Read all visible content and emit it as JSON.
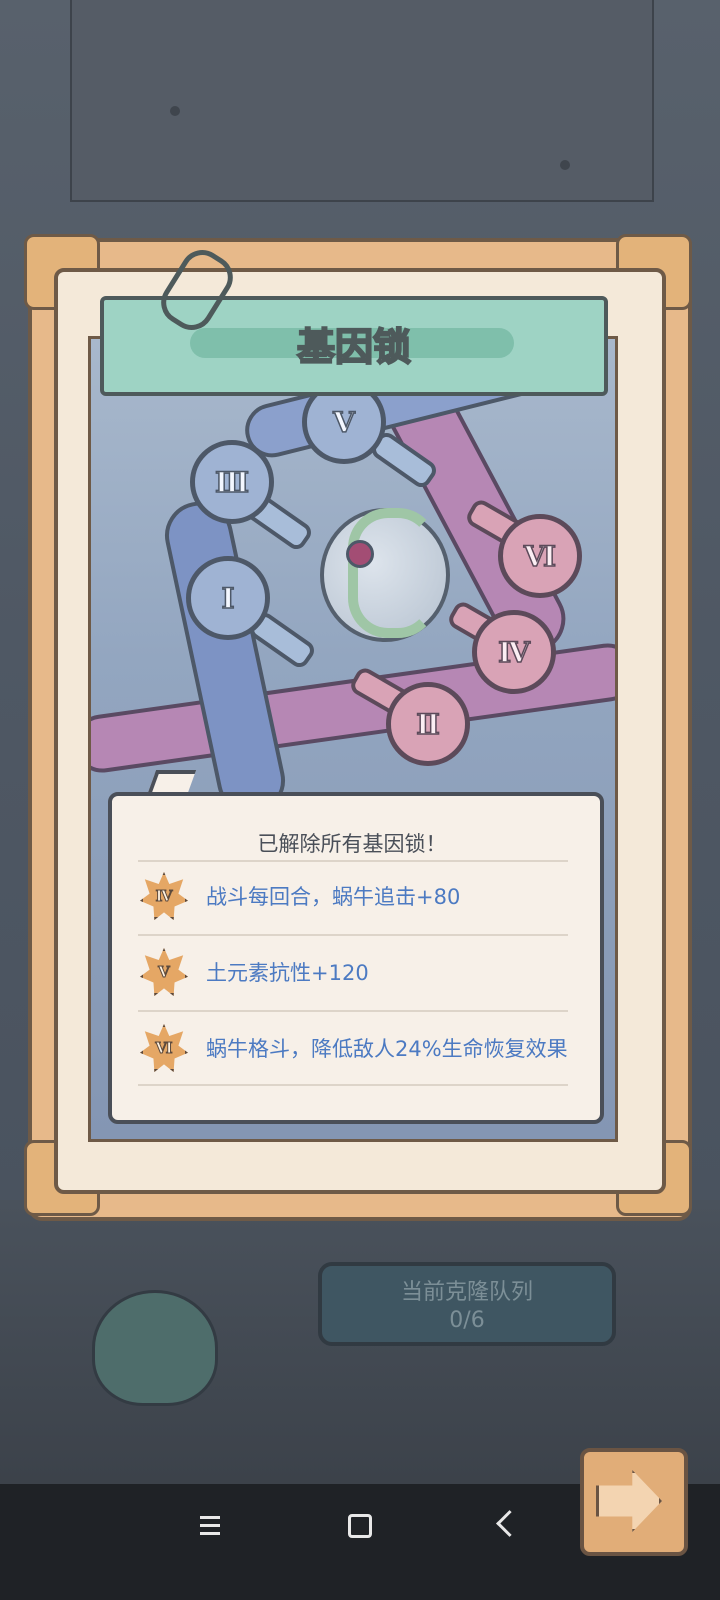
{
  "background": {
    "clone_queue_label": "当前克隆队列",
    "clone_queue_count": "0/6"
  },
  "gene_lock": {
    "title": "基因锁",
    "locks": [
      {
        "numeral": "V",
        "type": "blue"
      },
      {
        "numeral": "Ⅲ",
        "type": "blue"
      },
      {
        "numeral": "Ⅰ",
        "type": "blue"
      },
      {
        "numeral": "Ⅵ",
        "type": "pink"
      },
      {
        "numeral": "Ⅳ",
        "type": "pink"
      },
      {
        "numeral": "Ⅱ",
        "type": "pink"
      }
    ],
    "status_message": "已解除所有基因锁！",
    "bonuses": [
      {
        "badge": "Ⅳ",
        "text": "战斗每回合，蜗牛追击+80"
      },
      {
        "badge": "Ⅴ",
        "text": "土元素抗性+120"
      },
      {
        "badge": "Ⅵ",
        "text": "蜗牛格斗，降低敌人24%生命恢复效果"
      }
    ]
  },
  "colors": {
    "bonus_text": "#4c7ac2",
    "title_banner": "#9ed3c4",
    "frame": "#e7b98a"
  },
  "icons": {
    "next": "arrow-right-icon",
    "nav_menu": "menu-icon",
    "nav_home": "home-square-icon",
    "nav_back": "back-chevron-icon"
  }
}
